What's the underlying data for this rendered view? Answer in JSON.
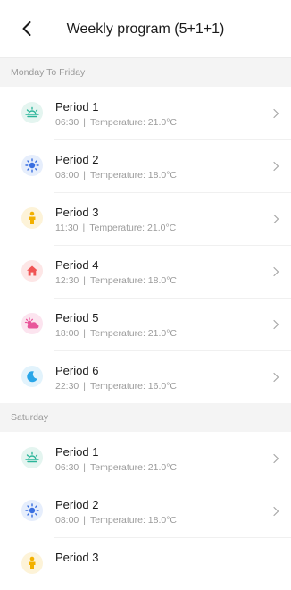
{
  "header": {
    "title": "Weekly program (5+1+1)"
  },
  "sections": [
    {
      "label": "Monday To Friday",
      "periods": [
        {
          "name": "Period 1",
          "time": "06:30",
          "temp": "Temperature: 21.0°C",
          "icon": "sunrise-icon"
        },
        {
          "name": "Period 2",
          "time": "08:00",
          "temp": "Temperature: 18.0°C",
          "icon": "sun-icon"
        },
        {
          "name": "Period 3",
          "time": "11:30",
          "temp": "Temperature: 21.0°C",
          "icon": "person-icon"
        },
        {
          "name": "Period 4",
          "time": "12:30",
          "temp": "Temperature: 18.0°C",
          "icon": "home-icon"
        },
        {
          "name": "Period 5",
          "time": "18:00",
          "temp": "Temperature: 21.0°C",
          "icon": "sunset-cloud-icon"
        },
        {
          "name": "Period 6",
          "time": "22:30",
          "temp": "Temperature: 16.0°C",
          "icon": "moon-icon"
        }
      ]
    },
    {
      "label": "Saturday",
      "periods": [
        {
          "name": "Period 1",
          "time": "06:30",
          "temp": "Temperature: 21.0°C",
          "icon": "sunrise-icon"
        },
        {
          "name": "Period 2",
          "time": "08:00",
          "temp": "Temperature: 18.0°C",
          "icon": "sun-icon"
        },
        {
          "name": "Period 3",
          "time": "",
          "temp": "",
          "icon": "person-icon"
        }
      ]
    }
  ],
  "colors": {
    "sunrise": "#2bb59a",
    "sun": "#3a6fe0",
    "person": "#f2b000",
    "home": "#f05454",
    "sunset": "#e8559a",
    "moon": "#2aa6e8"
  }
}
